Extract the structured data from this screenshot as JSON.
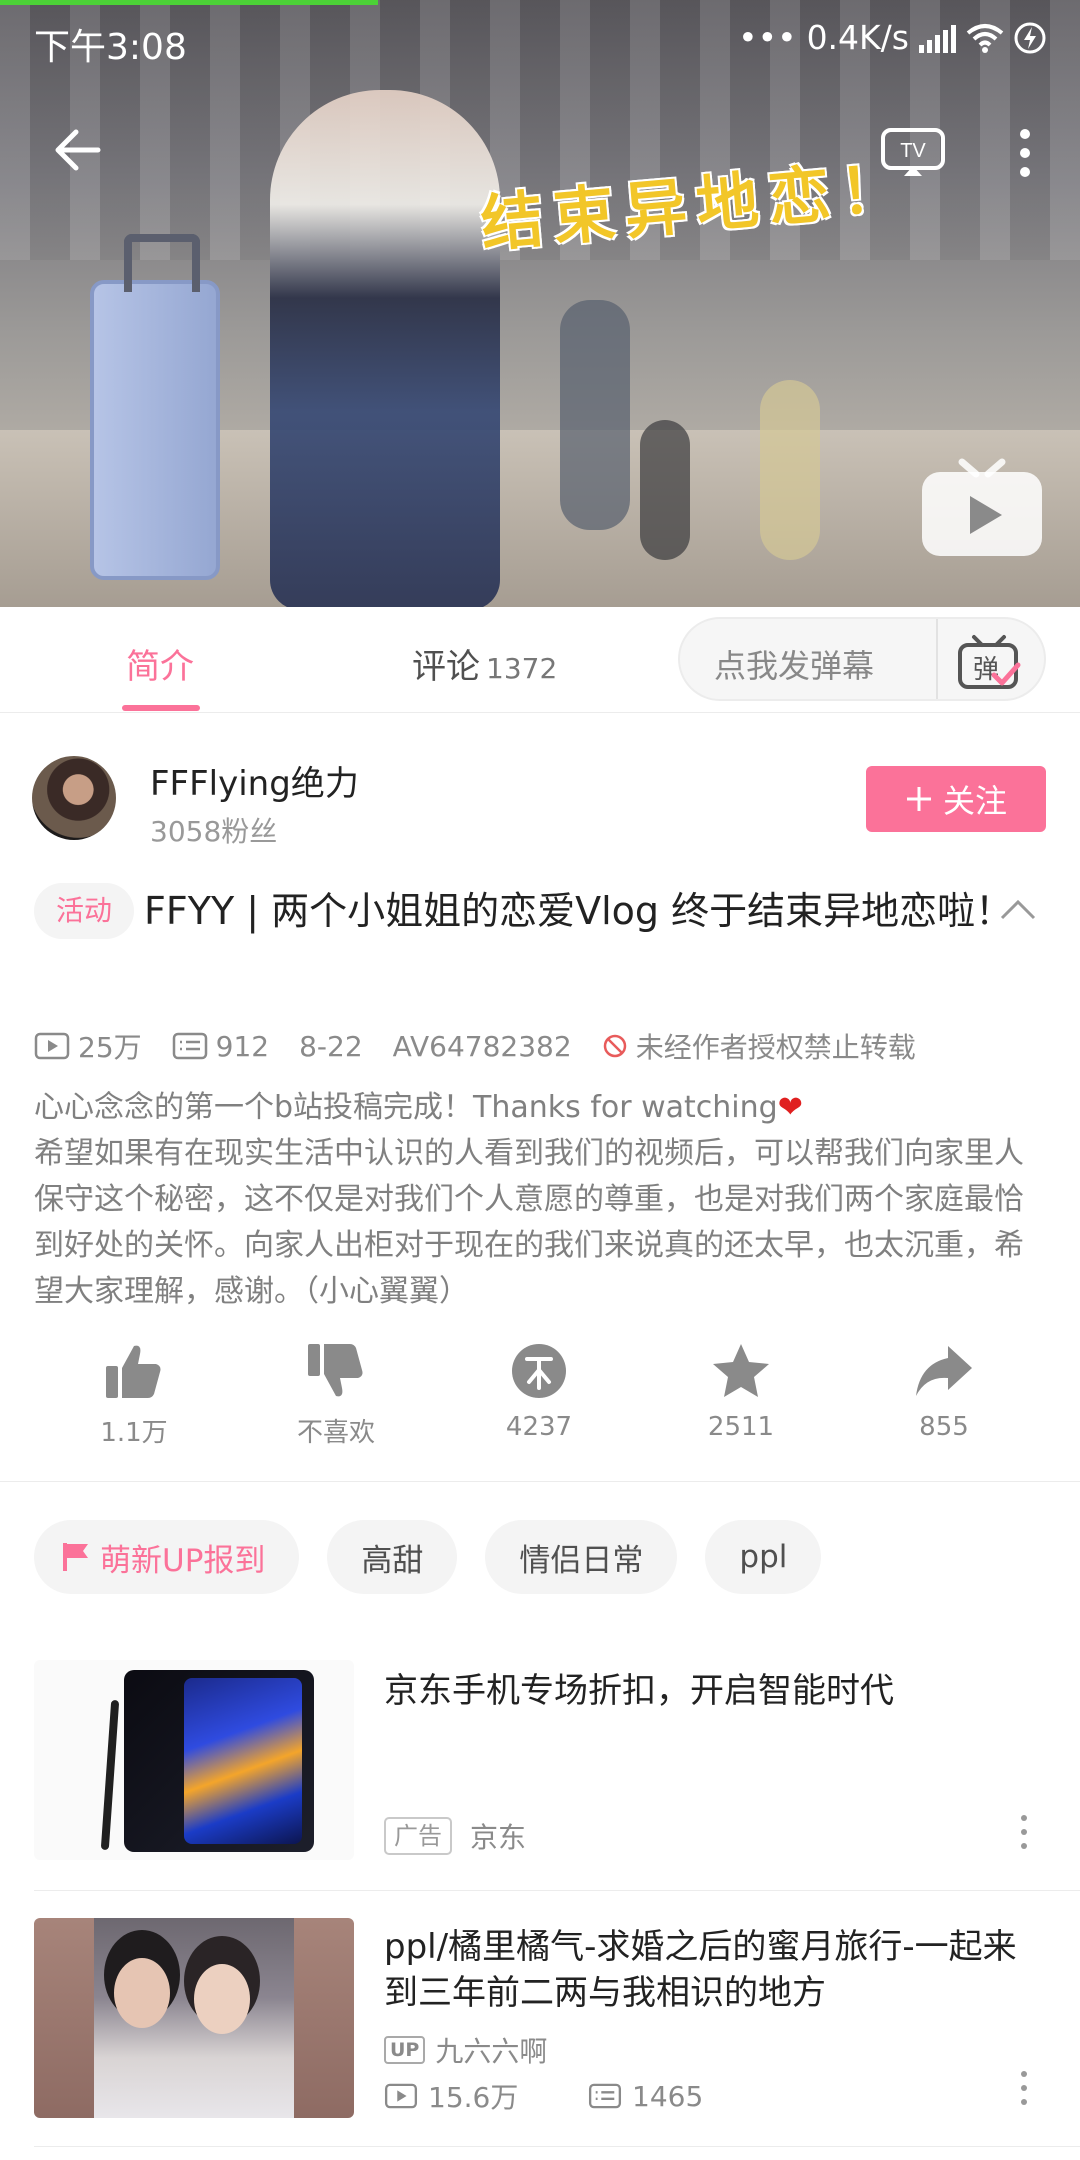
{
  "status_bar": {
    "time": "下午3:08",
    "network_speed": "0.4K/s"
  },
  "video": {
    "overlay_text": "结束异地恋！"
  },
  "tabs": {
    "intro_label": "简介",
    "comments_label": "评论",
    "comments_count": "1372",
    "danmaku_placeholder": "点我发弹幕",
    "danmaku_icon_char": "弹"
  },
  "uploader": {
    "name": "FFFlying绝力",
    "fans": "3058粉丝",
    "follow_label": "关注"
  },
  "video_info": {
    "badge": "活动",
    "title": "FFYY | 两个小姐姐的恋爱Vlog 终于结束异地恋啦！",
    "views": "25万",
    "danmaku": "912",
    "date": "8-22",
    "av": "AV64782382",
    "copyright": "未经作者授权禁止转载",
    "description_line1": "心心念念的第一个b站投稿完成！Thanks for watching",
    "description_heart": "❤",
    "description_rest": "希望如果有在现实生活中认识的人看到我们的视频后，可以帮我们向家里人保守这个秘密，这不仅是对我们个人意愿的尊重，也是对我们两个家庭最恰到好处的关怀。向家人出柜对于现在的我们来说真的还太早，也太沉重，希望大家理解，感谢。（小心翼翼）"
  },
  "actions": {
    "like": "1.1万",
    "dislike": "不喜欢",
    "coin": "4237",
    "favorite": "2511",
    "share": "855"
  },
  "tags": [
    "萌新UP报到",
    "高甜",
    "情侣日常",
    "ppl"
  ],
  "recommendations": [
    {
      "title": "京东手机专场折扣，开启智能时代",
      "ad_label": "广告",
      "source": "京东"
    },
    {
      "title": "ppl/橘里橘气-求婚之后的蜜月旅行-一起来到三年前二两与我相识的地方",
      "up_label": "UP",
      "uploader": "九六六啊",
      "views": "15.6万",
      "danmaku": "1465"
    }
  ],
  "colors": {
    "accent": "#fb7299",
    "progress": "#4cd137"
  }
}
